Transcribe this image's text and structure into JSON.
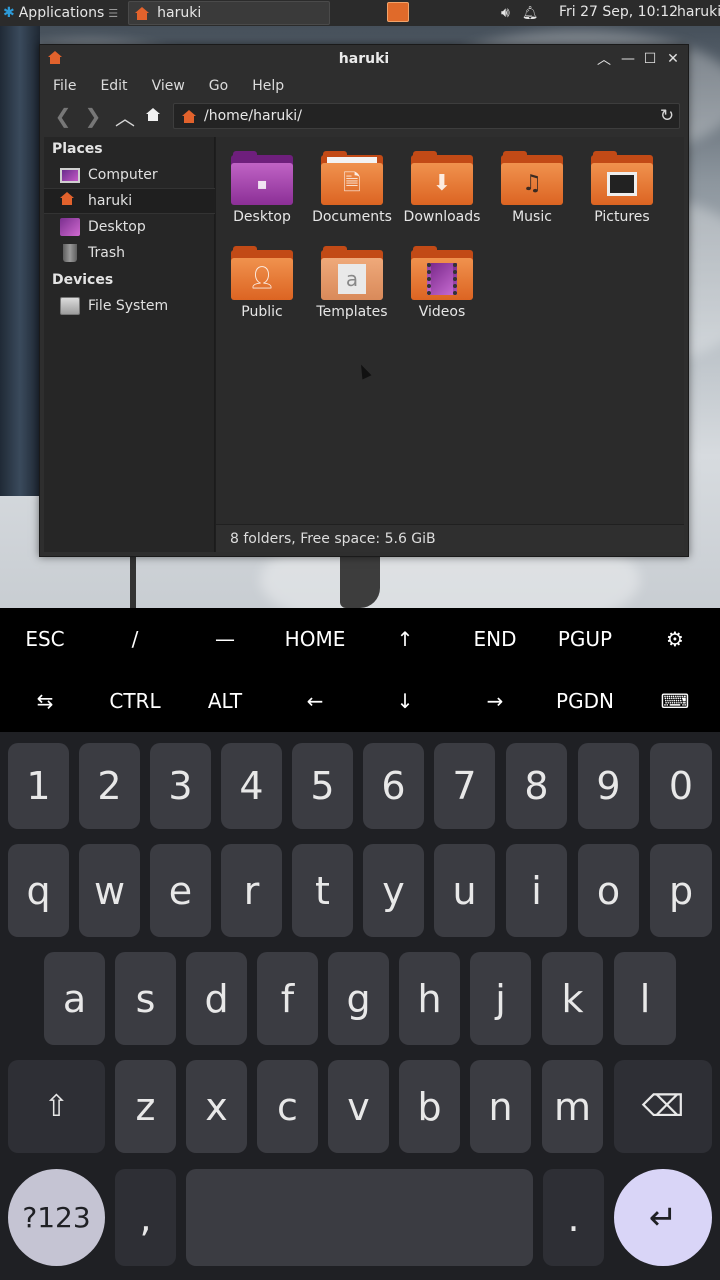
{
  "panel": {
    "apps_label": "Applications",
    "apps_separator": "☰",
    "task_label": "haruki",
    "datetime": "Fri 27 Sep, 10:12",
    "user": "haruki",
    "volume_icon": "volume-icon",
    "bell_icon": "bell-icon"
  },
  "window": {
    "title": "haruki",
    "menus": [
      "File",
      "Edit",
      "View",
      "Go",
      "Help"
    ],
    "path": "/home/haruki/"
  },
  "sidebar": {
    "places_heading": "Places",
    "places": [
      "Computer",
      "haruki",
      "Desktop",
      "Trash"
    ],
    "devices_heading": "Devices",
    "devices": [
      "File System"
    ],
    "selected": "haruki"
  },
  "files": [
    {
      "name": "Desktop",
      "kind": "desktop"
    },
    {
      "name": "Documents",
      "kind": "documents"
    },
    {
      "name": "Downloads",
      "kind": "downloads"
    },
    {
      "name": "Music",
      "kind": "music"
    },
    {
      "name": "Pictures",
      "kind": "pictures"
    },
    {
      "name": "Public",
      "kind": "public"
    },
    {
      "name": "Templates",
      "kind": "templates"
    },
    {
      "name": "Videos",
      "kind": "videos"
    }
  ],
  "status": "8 folders, Free space: 5.6 GiB",
  "extra_keys": {
    "row1": [
      "ESC",
      "/",
      "—",
      "HOME",
      "↑",
      "END",
      "PGUP",
      "⚙"
    ],
    "row2": [
      "⇆",
      "CTRL",
      "ALT",
      "←",
      "↓",
      "→",
      "PGDN",
      "⌨"
    ]
  },
  "keyboard": {
    "row_numbers": [
      "1",
      "2",
      "3",
      "4",
      "5",
      "6",
      "7",
      "8",
      "9",
      "0"
    ],
    "row_q": [
      "q",
      "w",
      "e",
      "r",
      "t",
      "y",
      "u",
      "i",
      "o",
      "p"
    ],
    "row_a": [
      "a",
      "s",
      "d",
      "f",
      "g",
      "h",
      "j",
      "k",
      "l"
    ],
    "row_z": [
      "z",
      "x",
      "c",
      "v",
      "b",
      "n",
      "m"
    ],
    "shift": "⇧",
    "backspace": "⌫",
    "symbols": "?123",
    "comma": ",",
    "period": ".",
    "enter": "↵"
  },
  "colors": {
    "accent": "#e2622c",
    "folder": "#dc6422",
    "enter_key": "#d9d5f7"
  }
}
